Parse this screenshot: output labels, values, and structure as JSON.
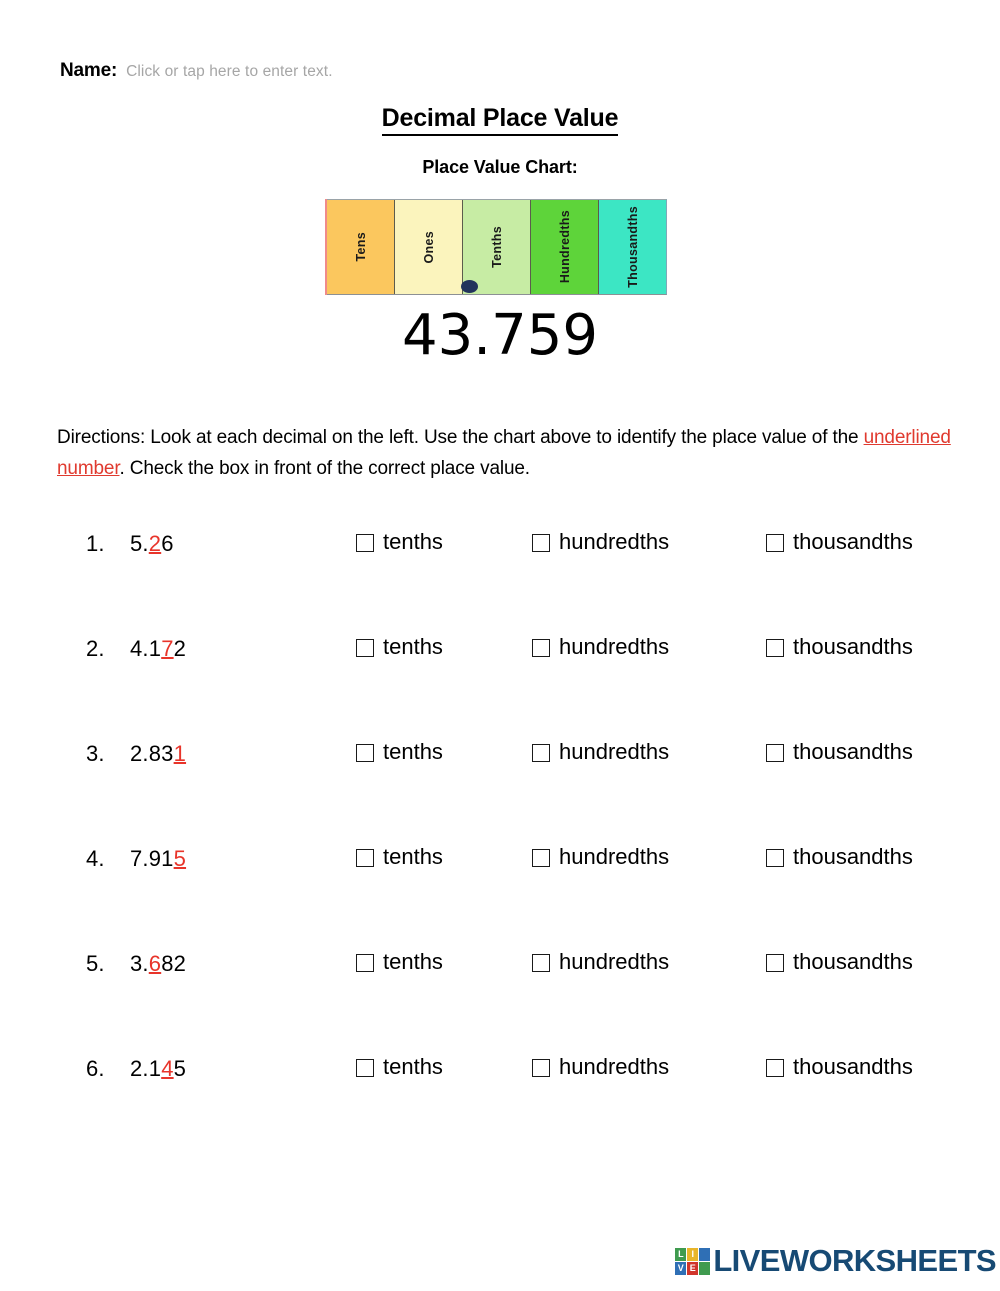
{
  "header": {
    "name_label": "Name:",
    "name_placeholder": "Click or tap here to enter text.",
    "title": "Decimal Place Value",
    "subtitle": "Place Value Chart:"
  },
  "place_value_chart": {
    "cells": [
      {
        "label": "Tens",
        "color": "#fbc75e"
      },
      {
        "label": "Ones",
        "color": "#fbf4bd"
      },
      {
        "label": "Tenths",
        "color": "#c7eca4"
      },
      {
        "label": "Hundredths",
        "color": "#5ed43a"
      },
      {
        "label": "Thousandths",
        "color": "#3ce6c4"
      }
    ],
    "decimal_point": "decimal-point-dot",
    "example_number": "43.759"
  },
  "directions": {
    "part1": "Directions:  Look at each decimal on the left.  Use the chart above to identify the place value of the ",
    "highlight": "underlined number",
    "part2": ".  Check the box in front of the correct place value.",
    "highlight_color": "#e03a2f"
  },
  "options": {
    "tenths": "tenths",
    "hundredths": "hundredths",
    "thousandths": "thousandths"
  },
  "questions": [
    {
      "number": "1.",
      "prefix": "5.",
      "digit": "2",
      "suffix": "6"
    },
    {
      "number": "2.",
      "prefix": "4.1",
      "digit": "7",
      "suffix": "2"
    },
    {
      "number": "3.",
      "prefix": "2.83",
      "digit": "1",
      "suffix": ""
    },
    {
      "number": "4.",
      "prefix": "7.91",
      "digit": "5",
      "suffix": ""
    },
    {
      "number": "5.",
      "prefix": "3.",
      "digit": "6",
      "suffix": "82"
    },
    {
      "number": "6.",
      "prefix": "2.1",
      "digit": "4",
      "suffix": "5"
    }
  ],
  "footer": {
    "logo_tiles": [
      "L",
      "I",
      "",
      "V",
      "E",
      ""
    ],
    "logo_text": "LIVEWORKSHEETS",
    "logo_color": "#174a74"
  }
}
